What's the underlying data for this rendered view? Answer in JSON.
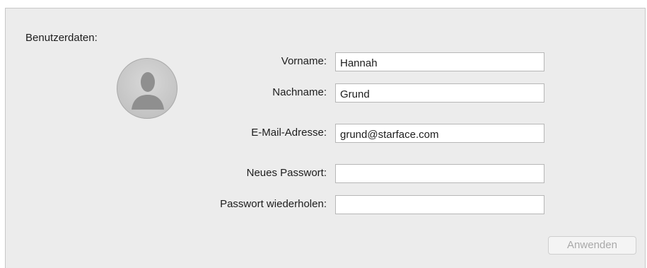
{
  "section": {
    "title": "Benutzerdaten:"
  },
  "avatar": {
    "icon": "user-silhouette-icon"
  },
  "fields": {
    "firstname": {
      "label": "Vorname:",
      "value": "Hannah"
    },
    "lastname": {
      "label": "Nachname:",
      "value": "Grund"
    },
    "email": {
      "label": "E-Mail-Adresse:",
      "value": "grund@starface.com"
    },
    "new_password": {
      "label": "Neues Passwort:",
      "value": ""
    },
    "repeat_password": {
      "label": "Passwort wiederholen:",
      "value": ""
    }
  },
  "actions": {
    "apply_label": "Anwenden",
    "apply_enabled": false
  }
}
